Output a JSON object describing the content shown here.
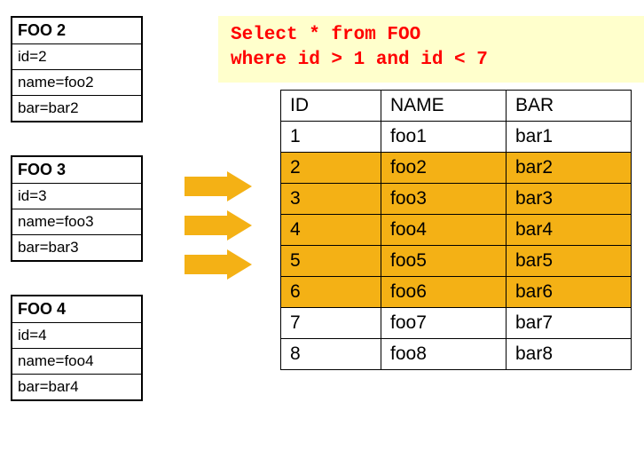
{
  "sql": {
    "line1": "Select * from FOO",
    "line2": "where id > 1 and id < 7"
  },
  "objects": [
    {
      "title": "FOO 2",
      "id_line": "id=2",
      "name_line": "name=foo2",
      "bar_line": "bar=bar2"
    },
    {
      "title": "FOO 3",
      "id_line": "id=3",
      "name_line": "name=foo3",
      "bar_line": "bar=bar3"
    },
    {
      "title": "FOO 4",
      "id_line": "id=4",
      "name_line": "name=foo4",
      "bar_line": "bar=bar4"
    }
  ],
  "table": {
    "headers": {
      "id": "ID",
      "name": "NAME",
      "bar": "BAR"
    },
    "rows": [
      {
        "id": "1",
        "name": "foo1",
        "bar": "bar1",
        "highlight": false
      },
      {
        "id": "2",
        "name": "foo2",
        "bar": "bar2",
        "highlight": true
      },
      {
        "id": "3",
        "name": "foo3",
        "bar": "bar3",
        "highlight": true
      },
      {
        "id": "4",
        "name": "foo4",
        "bar": "bar4",
        "highlight": true
      },
      {
        "id": "5",
        "name": "foo5",
        "bar": "bar5",
        "highlight": true
      },
      {
        "id": "6",
        "name": "foo6",
        "bar": "bar6",
        "highlight": true
      },
      {
        "id": "7",
        "name": "foo7",
        "bar": "bar7",
        "highlight": false
      },
      {
        "id": "8",
        "name": "foo8",
        "bar": "bar8",
        "highlight": false
      }
    ]
  },
  "colors": {
    "highlight": "#f4b115",
    "sql_bg": "#ffffcc",
    "sql_fg": "#ff0000"
  }
}
